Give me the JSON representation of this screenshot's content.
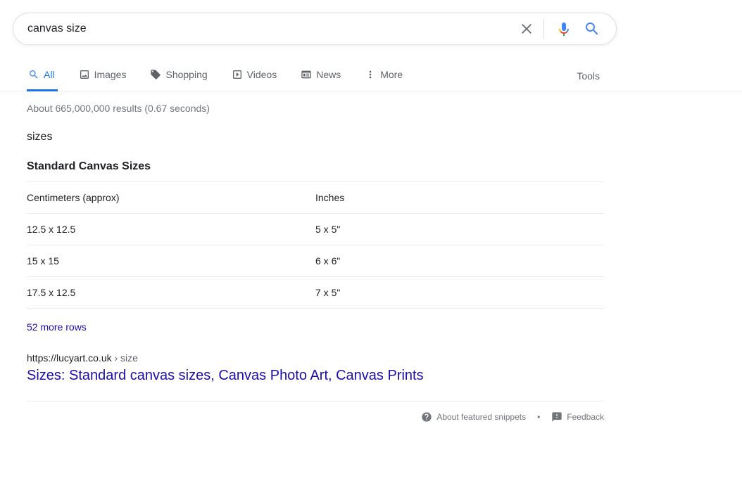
{
  "search": {
    "query": "canvas size"
  },
  "tabs": {
    "all": "All",
    "images": "Images",
    "shopping": "Shopping",
    "videos": "Videos",
    "news": "News",
    "more": "More",
    "tools": "Tools"
  },
  "result_stats": "About 665,000,000 results (0.67 seconds)",
  "snippet": {
    "caption": "sizes",
    "title": "Standard Canvas Sizes",
    "headers": {
      "cm": "Centimeters (approx)",
      "in": "Inches"
    },
    "rows": [
      {
        "cm": "12.5 x 12.5",
        "in": "5 x 5\""
      },
      {
        "cm": "15 x 15",
        "in": "6 x 6\""
      },
      {
        "cm": "17.5 x 12.5",
        "in": "7 x 5\""
      }
    ],
    "more_rows": "52 more rows"
  },
  "result": {
    "cite_domain": "https://lucyart.co.uk",
    "cite_path": " › size",
    "title": "Sizes: Standard canvas sizes, Canvas Photo Art, Canvas Prints"
  },
  "footer": {
    "about": "About featured snippets",
    "feedback": "Feedback"
  }
}
